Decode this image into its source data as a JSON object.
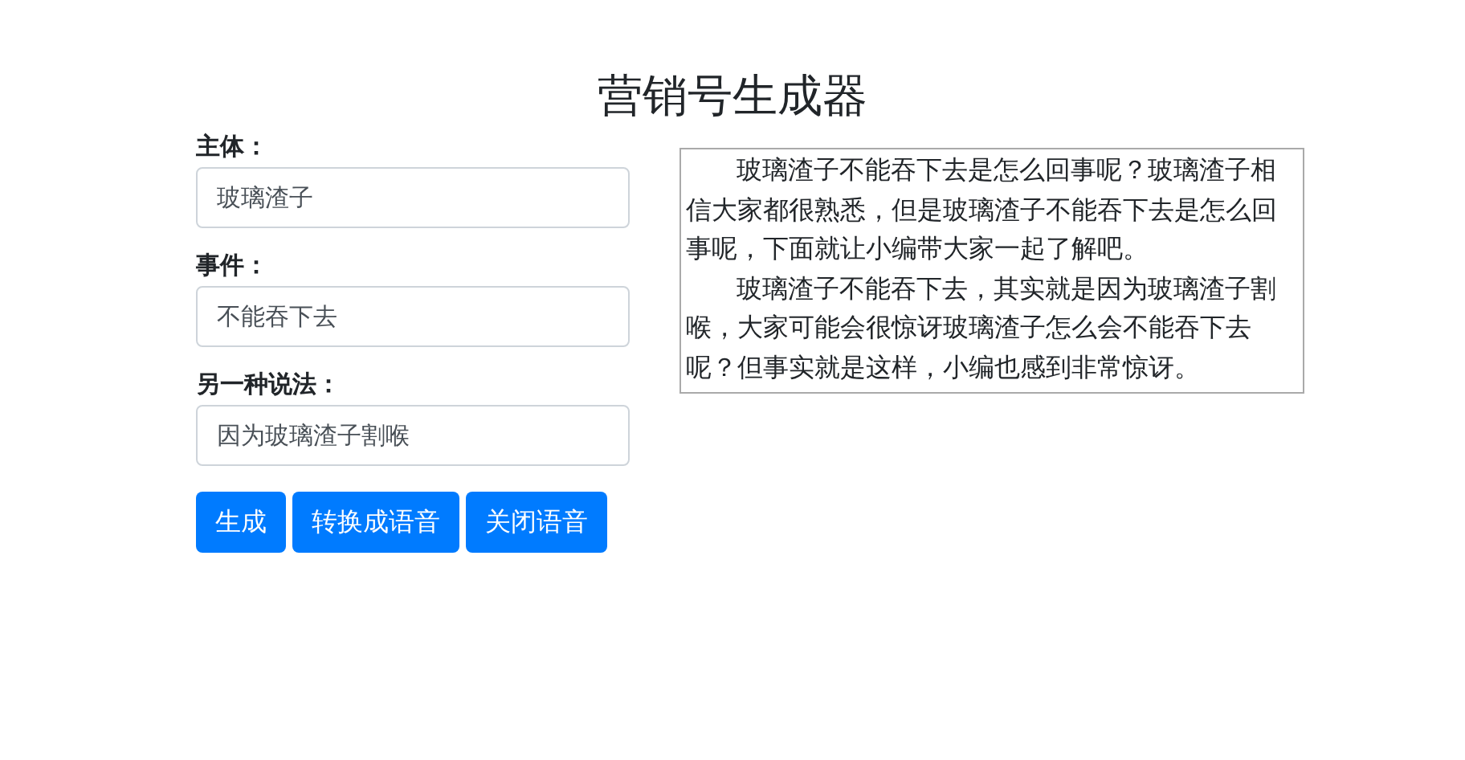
{
  "title": "营销号生成器",
  "fields": [
    {
      "label": "主体：",
      "value": "玻璃渣子"
    },
    {
      "label": "事件：",
      "value": "不能吞下去"
    },
    {
      "label": "另一种说法：",
      "value": "因为玻璃渣子割喉"
    }
  ],
  "buttons": [
    "生成",
    "转换成语音",
    "关闭语音"
  ],
  "output": {
    "paragraphs": [
      "玻璃渣子不能吞下去是怎么回事呢？玻璃渣子相信大家都很熟悉，但是玻璃渣子不能吞下去是怎么回事呢，下面就让小编带大家一起了解吧。",
      "玻璃渣子不能吞下去，其实就是因为玻璃渣子割喉，大家可能会很惊讶玻璃渣子怎么会不能吞下去呢？但事实就是这样，小编也感到非常惊讶。"
    ]
  }
}
